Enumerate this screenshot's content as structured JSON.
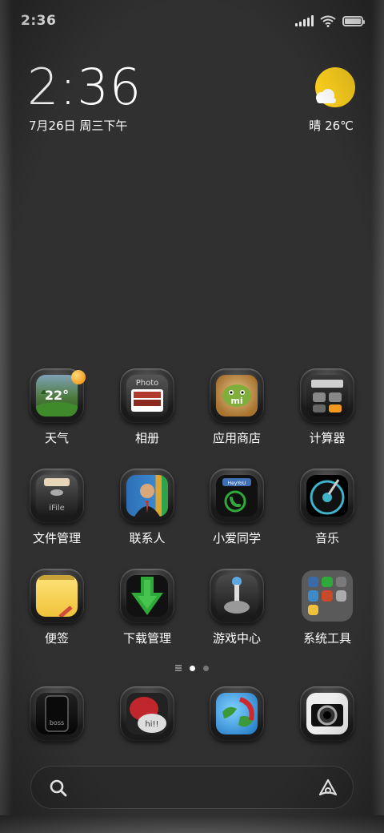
{
  "status_bar": {
    "time": "2:36"
  },
  "clock_widget": {
    "time": "2:36",
    "date": "7月26日 周三下午",
    "weather": "晴 26℃"
  },
  "apps": [
    {
      "label": "天气",
      "icon": "weather-icon"
    },
    {
      "label": "相册",
      "icon": "gallery-icon"
    },
    {
      "label": "应用商店",
      "icon": "app-store-icon"
    },
    {
      "label": "计算器",
      "icon": "calculator-icon"
    },
    {
      "label": "文件管理",
      "icon": "file-manager-icon"
    },
    {
      "label": "联系人",
      "icon": "contacts-icon"
    },
    {
      "label": "小爱同学",
      "icon": "assistant-icon"
    },
    {
      "label": "音乐",
      "icon": "music-icon"
    },
    {
      "label": "便签",
      "icon": "notes-icon"
    },
    {
      "label": "下载管理",
      "icon": "downloads-icon"
    },
    {
      "label": "游戏中心",
      "icon": "game-center-icon"
    },
    {
      "label": "系统工具",
      "icon": "system-tools-folder-icon"
    }
  ],
  "weather_icon_text": "22°",
  "gallery_icon_text": "Photo",
  "assistant_icon_text": "HeyYoU",
  "file_icon_text": "iFile",
  "dock": [
    {
      "icon": "phone-icon",
      "text": "boss"
    },
    {
      "icon": "messages-icon",
      "text": "hi!!"
    },
    {
      "icon": "browser-icon"
    },
    {
      "icon": "camera-icon"
    }
  ],
  "page_indicator": {
    "pages": 2,
    "active": 1
  },
  "colors": {
    "background": "#303030",
    "sun": "#ffd21e",
    "accent_green": "#2faa3a"
  }
}
